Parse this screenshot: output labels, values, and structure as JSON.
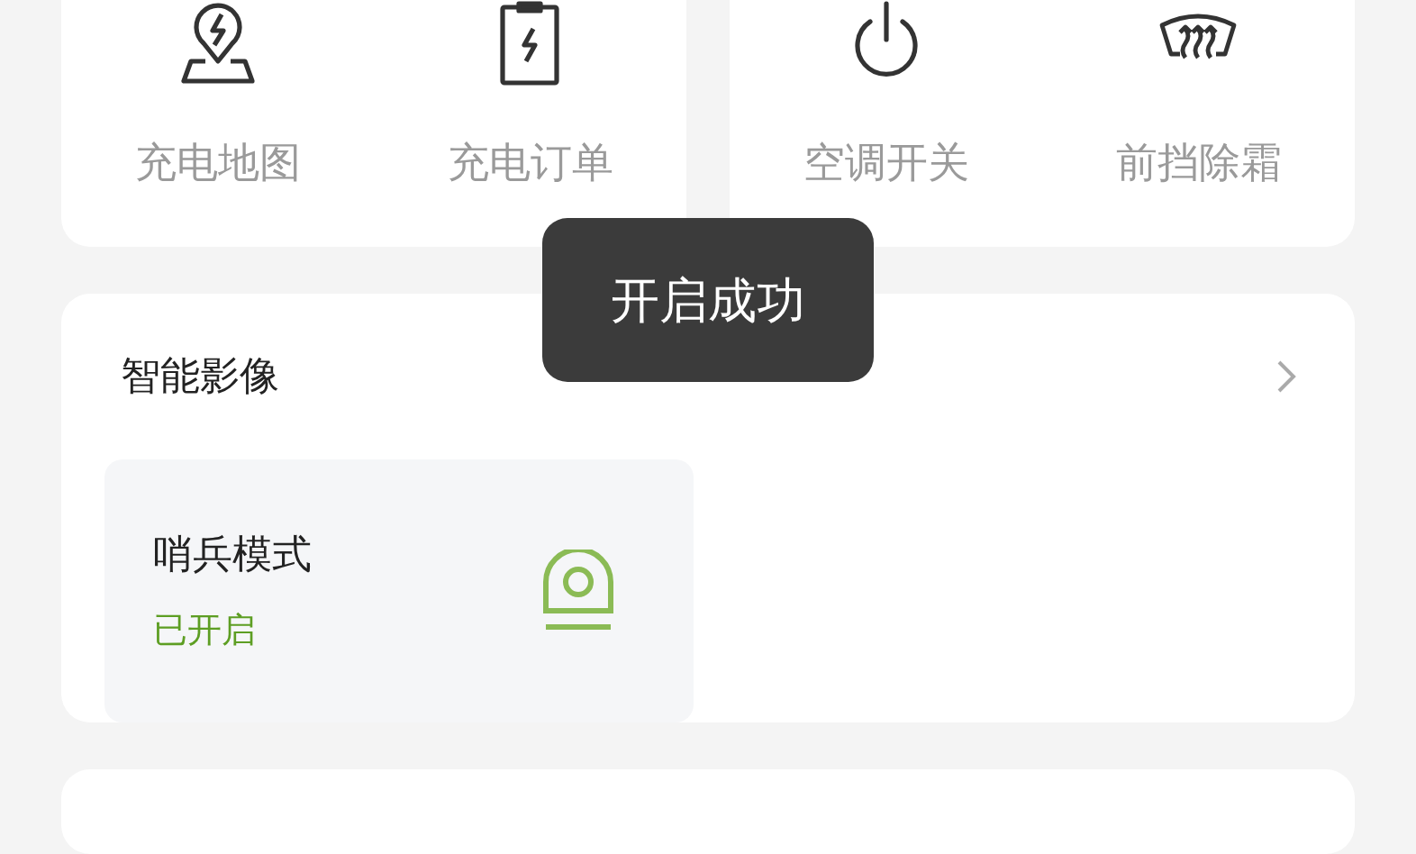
{
  "shortcut_groups": [
    {
      "items": [
        {
          "label": "充电地图"
        },
        {
          "label": "充电订单"
        }
      ]
    },
    {
      "items": [
        {
          "label": "空调开关"
        },
        {
          "label": "前挡除霜"
        }
      ]
    }
  ],
  "smart_video": {
    "title": "智能影像",
    "tiles": [
      {
        "name": "哨兵模式",
        "status": "已开启",
        "on": true
      }
    ]
  },
  "toast": {
    "text": "开启成功"
  }
}
